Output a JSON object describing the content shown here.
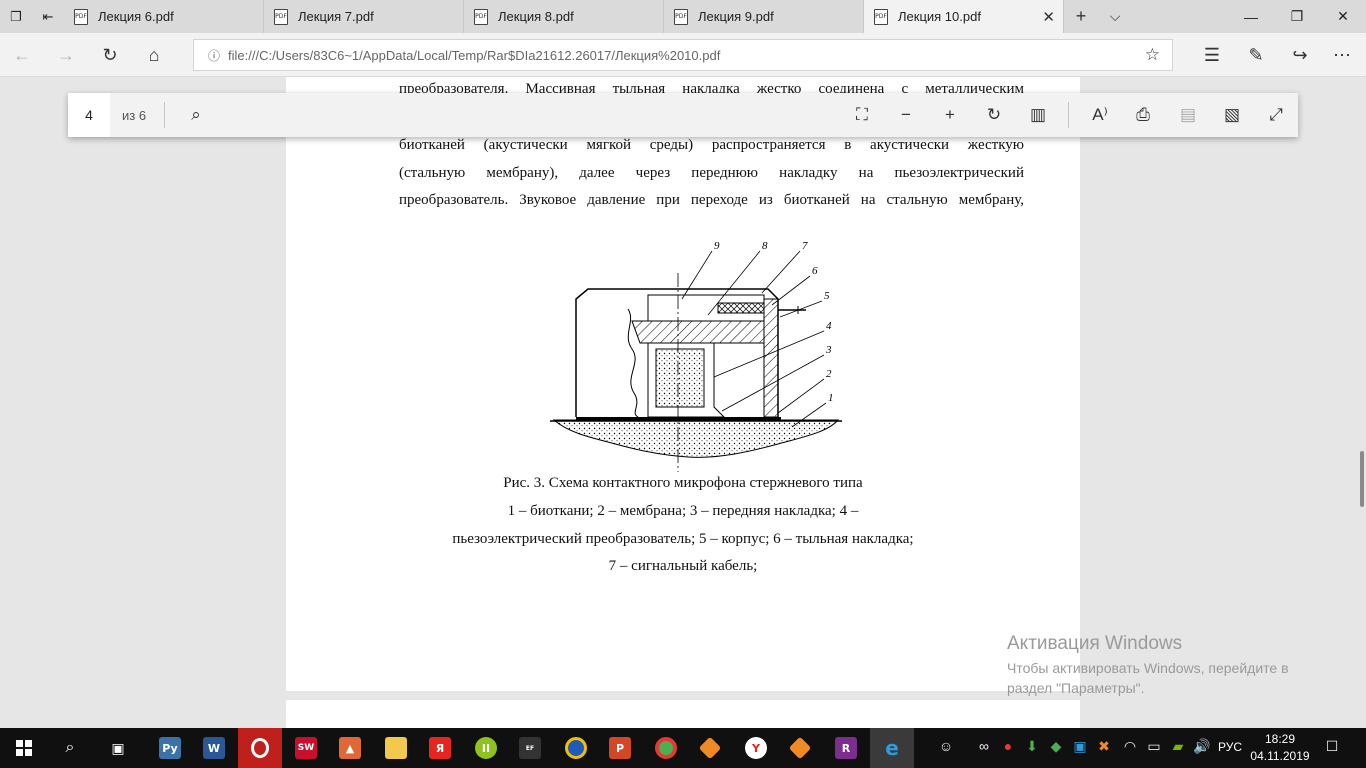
{
  "tabs": [
    {
      "label": "Лекция 6.pdf",
      "icon": "pdf-icon"
    },
    {
      "label": "Лекция 7.pdf",
      "icon": "pdf-icon"
    },
    {
      "label": "Лекция 8.pdf",
      "icon": "pdf-icon"
    },
    {
      "label": "Лекция 9.pdf",
      "icon": "pdf-icon"
    },
    {
      "label": "Лекция 10.pdf",
      "icon": "pdf-icon",
      "active": true
    }
  ],
  "address": {
    "url": "file:///C:/Users/83C6~1/AppData/Local/Temp/Rar$DIa21612.26017/Лекция%2010.pdf"
  },
  "pdf_toolbar": {
    "page_number": "4",
    "page_count": "из 6"
  },
  "document": {
    "lines": [
      "преобразователя. Массивная тыльная накладка жестко соединена с металлическим",
      "биотканей (акустически мягкой среды) распространяется в акустически жесткую",
      "(стальную мембрану), далее через переднюю накладку на пьезоэлектрический",
      "преобразователь. Звуковое давление при переходе из биотканей на стальную мембрану,"
    ],
    "figure_labels": [
      "9",
      "8",
      "7",
      "6",
      "5",
      "4",
      "3",
      "2",
      "1"
    ],
    "caption": [
      "Рис. 3. Схема контактного микрофона стержневого типа",
      "1 – биоткани; 2 – мембрана; 3 – передняя накладка; 4 –",
      "пьезоэлектрический преобразователь; 5 – корпус; 6 – тыльная накладка;",
      "7 – сигнальный кабель;"
    ]
  },
  "watermark": {
    "title": "Активация Windows",
    "subtitle": "Чтобы активировать Windows, перейдите в раздел \"Параметры\"."
  },
  "taskbar": {
    "language": "РУС",
    "time": "18:29",
    "date": "04.11.2019"
  }
}
